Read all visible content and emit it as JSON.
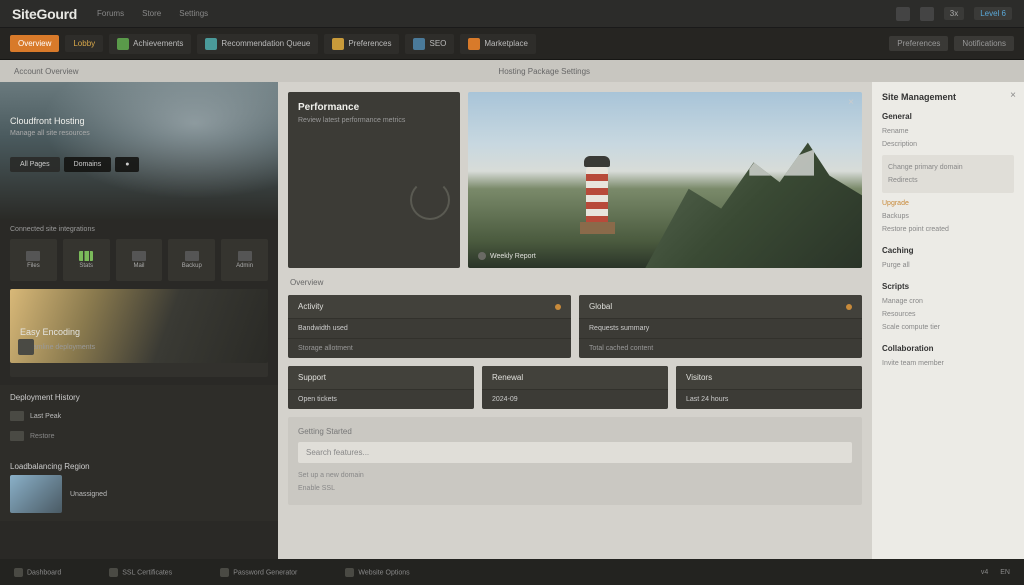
{
  "brand": "SiteGourd",
  "header_tabs": [
    "Forums",
    "Store",
    "Settings"
  ],
  "header_chips": {
    "a": "3x",
    "b": "Level 6"
  },
  "nav": {
    "tabs": [
      {
        "label": "Overview",
        "cls": "active"
      },
      {
        "label": "Lobby",
        "cls": "alt"
      },
      {
        "label": "Achievements",
        "icon": "green"
      },
      {
        "label": "Recommendation Queue",
        "icon": "teal"
      },
      {
        "label": "Preferences",
        "icon": "gold"
      },
      {
        "label": "SEO",
        "icon": "blue"
      },
      {
        "label": "Marketplace",
        "icon": "orange"
      }
    ],
    "right": [
      "Preferences",
      "Notifications"
    ]
  },
  "breadcrumb": {
    "left": "Account Overview",
    "mid": "Hosting Package Settings"
  },
  "sidebar": {
    "hero": {
      "title": "Cloudfront Hosting",
      "sub": "Manage all site resources"
    },
    "pills": [
      "All Pages",
      "Domains"
    ],
    "label1": "Connected site integrations",
    "tiles": [
      "Files",
      "Stats",
      "Mail",
      "Backup",
      "Admin"
    ],
    "card": {
      "title": "Easy Encoding",
      "sub": "Streamline deployments"
    },
    "section2": "Deployment History",
    "rows": [
      "Last Peak",
      "Restore"
    ],
    "section3": "Loadbalancing Region",
    "row3": "Unassigned"
  },
  "main": {
    "intro": {
      "title": "Performance",
      "sub": "Review latest performance metrics"
    },
    "hero_caption": "Weekly Report",
    "sublabel": "Overview",
    "cards": [
      {
        "head": "Activity",
        "rows": [
          "Bandwidth used",
          "Storage allotment"
        ]
      },
      {
        "head": "Global",
        "rows": [
          "Requests summary",
          "Total cached content"
        ]
      },
      {
        "head": "Support",
        "rows": [
          "Open tickets"
        ]
      },
      {
        "head": "Renewal",
        "rows": [
          "2024-09"
        ]
      },
      {
        "head": "Visitors",
        "rows": [
          "Last 24 hours"
        ]
      }
    ],
    "wide": {
      "title": "Getting Started",
      "placeholder": "Search features...",
      "links": [
        "Set up a new domain",
        "Enable SSL"
      ]
    }
  },
  "rpanel": {
    "title": "Site Management",
    "sections": [
      {
        "head": "General",
        "items": [
          "Rename",
          "Description"
        ]
      },
      {
        "head": "",
        "box_items": [
          "Change primary domain",
          "Redirects"
        ],
        "hl": "Upgrade"
      },
      {
        "head": "",
        "items": [
          "Backups",
          "Restore point created"
        ]
      },
      {
        "head": "Caching",
        "items": [
          "Purge all"
        ]
      },
      {
        "head": "Scripts",
        "items": [
          "Manage cron"
        ]
      },
      {
        "head": "",
        "items": [
          "Resources",
          "Scale compute tier"
        ]
      },
      {
        "head": "Collaboration",
        "items": [
          "Invite team member"
        ]
      }
    ]
  },
  "footer": {
    "items": [
      "Dashboard",
      "SSL Certificates",
      "Password Generator",
      "Website Options"
    ],
    "right": [
      "v4",
      "EN"
    ]
  }
}
